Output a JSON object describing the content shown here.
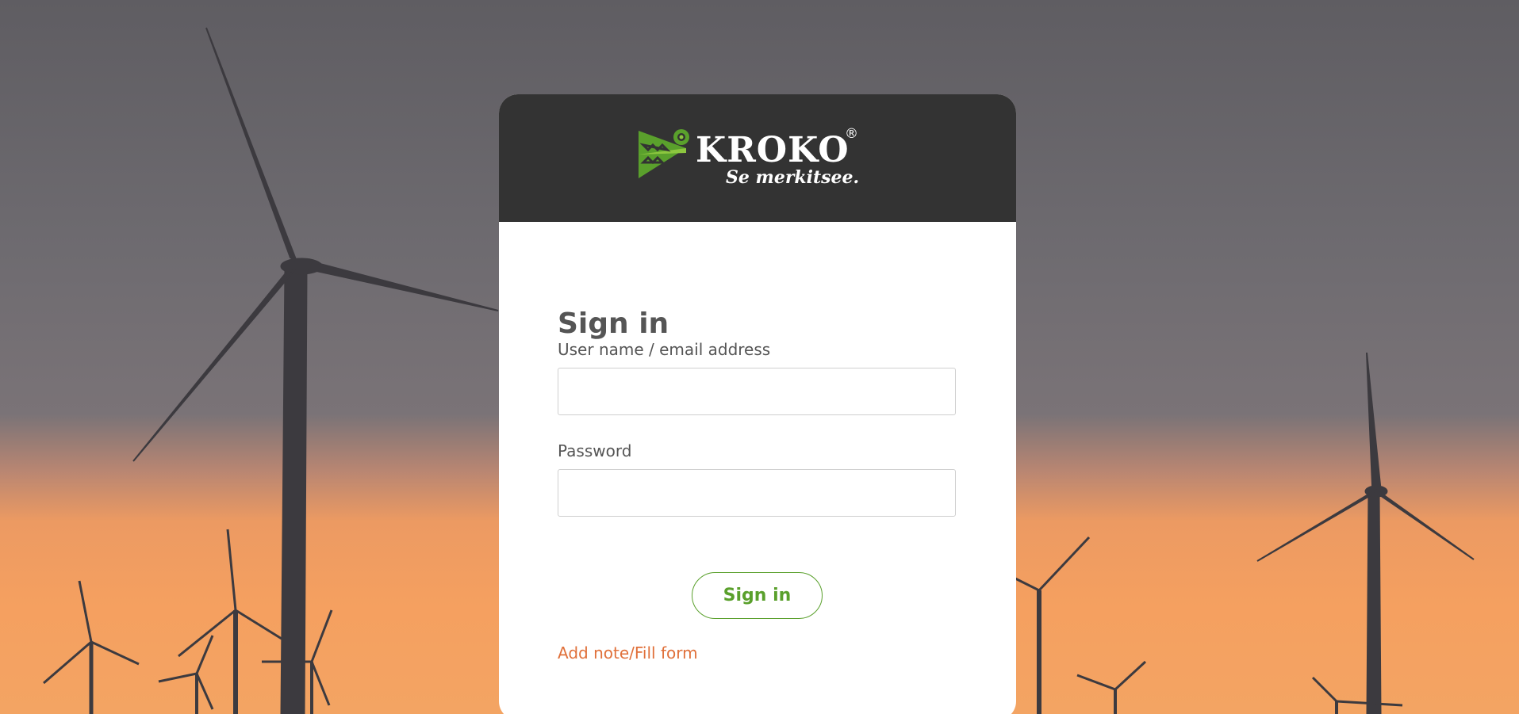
{
  "logo": {
    "brand": "KROKO",
    "registered": "®",
    "tagline": "Se merkitsee."
  },
  "form": {
    "title": "Sign in",
    "username_label": "User name / email address",
    "username_value": "",
    "password_label": "Password",
    "password_value": "",
    "submit_label": "Sign in",
    "note_link": "Add note/Fill form"
  },
  "colors": {
    "accent_green": "#5aa02c",
    "link_orange": "#e0703a",
    "header_dark": "#333333"
  }
}
